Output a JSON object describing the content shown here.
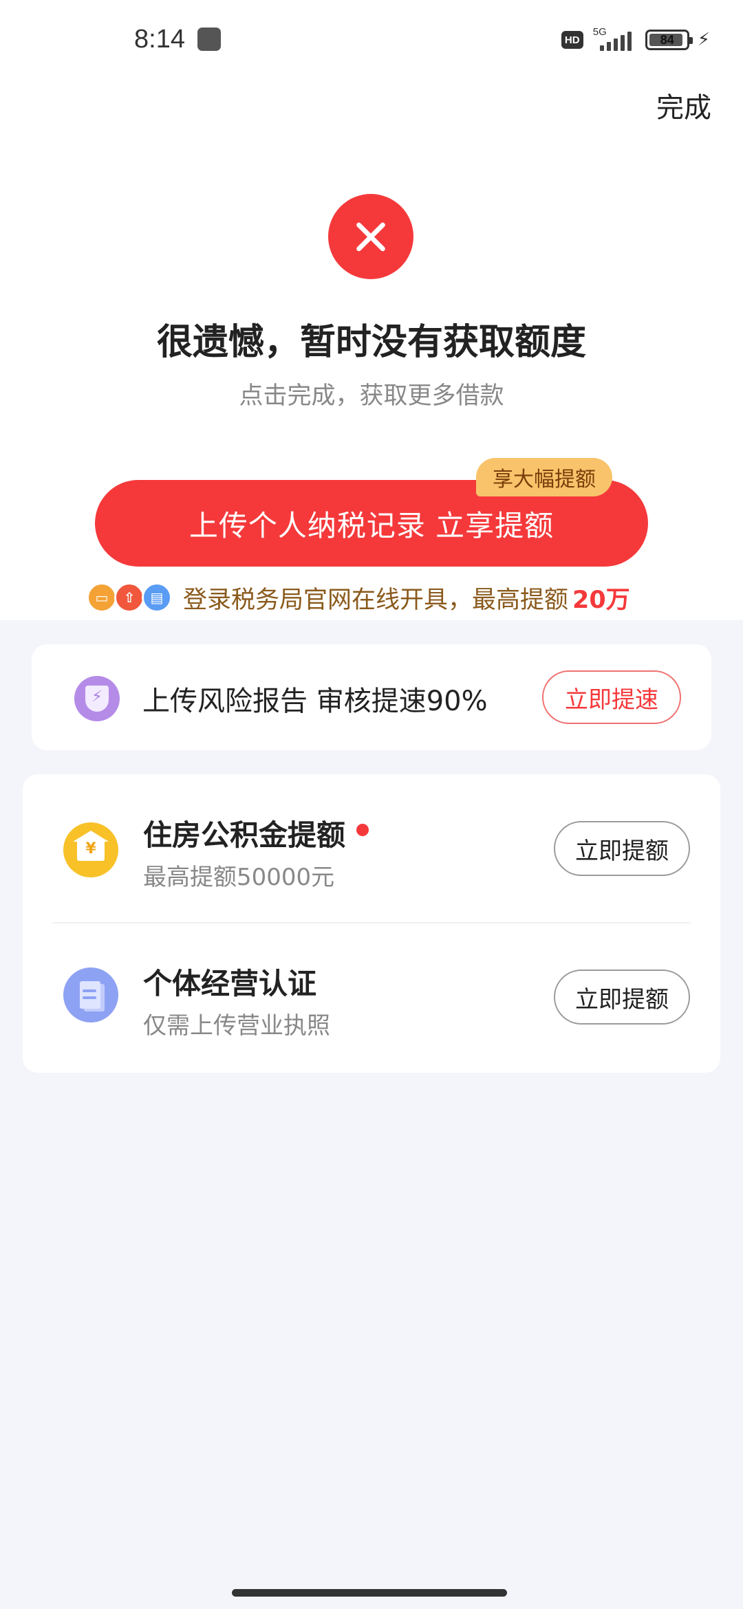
{
  "status_bar": {
    "time": "8:14",
    "network": "5G",
    "hd_label": "HD",
    "battery": "84"
  },
  "header": {
    "done_label": "完成"
  },
  "result": {
    "title": "很遗憾，暂时没有获取额度",
    "subtitle": "点击完成，获取更多借款"
  },
  "tax_upload": {
    "button_label": "上传个人纳税记录 立享提额",
    "badge": "享大幅提额",
    "note": "登录税务局官网在线开具，最高提额",
    "note_amount": "20万"
  },
  "risk_card": {
    "text": "上传风险报告 审核提速90%",
    "button_label": "立即提速"
  },
  "options": [
    {
      "title": "住房公积金提额",
      "subtitle": "最高提额50000元",
      "button_label": "立即提额",
      "icon": "house-yen-icon"
    },
    {
      "title": "个体经营认证",
      "subtitle": "仅需上传营业执照",
      "button_label": "立即提额",
      "icon": "document-icon"
    }
  ],
  "colors": {
    "primary_red": "#f5393b",
    "badge_gold": "#f8c36a",
    "background": "#f4f5fa"
  }
}
